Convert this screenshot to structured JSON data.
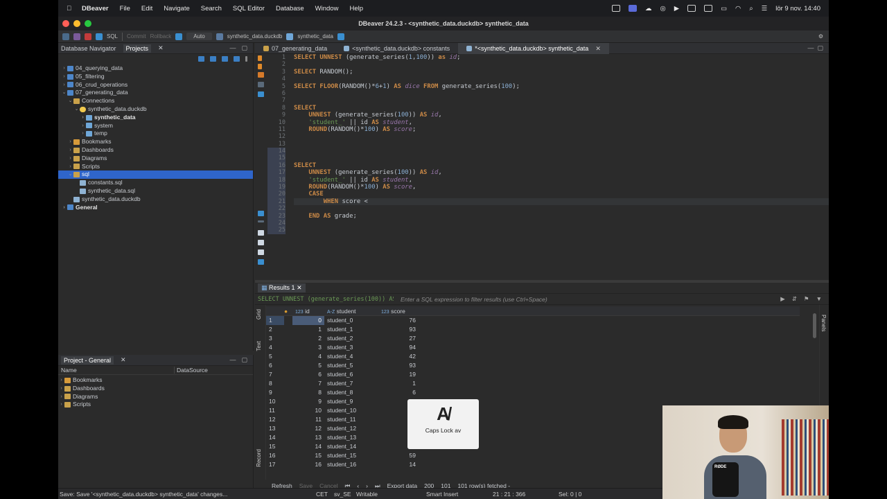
{
  "menubar": {
    "app": "DBeaver",
    "items": [
      "File",
      "Edit",
      "Navigate",
      "Search",
      "SQL Editor",
      "Database",
      "Window",
      "Help"
    ],
    "clock": "lör 9 nov. 14:40"
  },
  "window": {
    "title": "DBeaver 24.2.3 - <synthetic_data.duckdb> synthetic_data",
    "toolbar": {
      "sql_label": "SQL",
      "commit_label": "Commit",
      "rollback_label": "Rollback",
      "auto_label": "Auto",
      "datasource": "synthetic_data.duckdb",
      "schema": "synthetic_data"
    }
  },
  "left": {
    "tabs": [
      "Database Navigator",
      "Projects"
    ],
    "tree": [
      {
        "label": "04_querying_data",
        "icon": "project-icon",
        "indent": 0,
        "arrow": "›"
      },
      {
        "label": "05_filtering",
        "icon": "project-icon",
        "indent": 0,
        "arrow": "›"
      },
      {
        "label": "06_crud_operations",
        "icon": "project-icon",
        "indent": 0,
        "arrow": "›"
      },
      {
        "label": "07_generating_data",
        "icon": "project-icon",
        "indent": 0,
        "arrow": "⌄"
      },
      {
        "label": "Connections",
        "icon": "folder-icon",
        "indent": 1,
        "arrow": "⌄"
      },
      {
        "label": "synthetic_data.duckdb",
        "icon": "database-icon",
        "indent": 2,
        "arrow": "⌄"
      },
      {
        "label": "synthetic_data",
        "icon": "schema-icon",
        "indent": 3,
        "arrow": "›",
        "bold": true
      },
      {
        "label": "system",
        "icon": "schema-icon",
        "indent": 3,
        "arrow": "›"
      },
      {
        "label": "temp",
        "icon": "schema-icon",
        "indent": 3,
        "arrow": "›"
      },
      {
        "label": "Bookmarks",
        "icon": "bookmark-icon",
        "indent": 1,
        "arrow": "›"
      },
      {
        "label": "Dashboards",
        "icon": "folder-icon",
        "indent": 1,
        "arrow": "›"
      },
      {
        "label": "Diagrams",
        "icon": "folder-icon",
        "indent": 1,
        "arrow": "›"
      },
      {
        "label": "Scripts",
        "icon": "folder-icon",
        "indent": 1,
        "arrow": "›"
      },
      {
        "label": "sql",
        "icon": "folder-icon",
        "indent": 1,
        "arrow": "⌄",
        "selected": true
      },
      {
        "label": "constants.sql",
        "icon": "file-icon",
        "indent": 2,
        "arrow": ""
      },
      {
        "label": "synthetic_data.sql",
        "icon": "file-icon",
        "indent": 2,
        "arrow": ""
      },
      {
        "label": "synthetic_data.duckdb",
        "icon": "file-icon",
        "indent": 1,
        "arrow": ""
      },
      {
        "label": "General",
        "icon": "project-icon",
        "indent": 0,
        "arrow": "›",
        "bold": true
      }
    ],
    "project_tab": "Project - General",
    "project_columns": [
      "Name",
      "DataSource"
    ],
    "project_items": [
      "Bookmarks",
      "Dashboards",
      "Diagrams",
      "Scripts"
    ]
  },
  "editor": {
    "tabs": [
      "07_generating_data",
      "<synthetic_data.duckdb> constants",
      "*<synthetic_data.duckdb> synthetic_data"
    ],
    "line_numbers": [
      "1",
      "2",
      "3",
      "4",
      "5",
      "6",
      "7",
      "8",
      "9",
      "10",
      "11",
      "12",
      "13",
      "14",
      "15",
      "16",
      "17",
      "18",
      "19",
      "20",
      "21",
      "22",
      "23",
      "24",
      "25"
    ],
    "code": [
      "SELECT UNNEST (generate_series(1,100)) as id;",
      "",
      "SELECT RANDOM();",
      "",
      "SELECT FLOOR(RANDOM()*6+1) AS dice FROM generate_series(100);",
      "",
      "",
      "SELECT",
      "    UNNEST (generate_series(100)) AS id,",
      "    'student_' || id AS student,",
      "    ROUND(RANDOM()*100) AS score;",
      "",
      "",
      "",
      "",
      "SELECT",
      "    UNNEST (generate_series(100)) AS id,",
      "    'student_' || id AS student,",
      "    ROUND(RANDOM()*100) AS score,",
      "    CASE",
      "        WHEN score <",
      "",
      "    END AS grade;",
      "",
      ""
    ]
  },
  "results": {
    "tab": "Results 1",
    "filter_query": "SELECT UNNEST (generate_series(100)) AS id,",
    "filter_hint": "Enter a SQL expression to filter results (use Ctrl+Space)",
    "side_tabs": [
      "Grid",
      "Text",
      "Record"
    ],
    "right_tab": "Panels",
    "columns": [
      {
        "type": "123",
        "name": "id"
      },
      {
        "type": "A-Z",
        "name": "student"
      },
      {
        "type": "123",
        "name": "score"
      }
    ],
    "rows": [
      {
        "n": "1",
        "id": "0",
        "student": "student_0",
        "score": "76"
      },
      {
        "n": "2",
        "id": "1",
        "student": "student_1",
        "score": "93"
      },
      {
        "n": "3",
        "id": "2",
        "student": "student_2",
        "score": "27"
      },
      {
        "n": "4",
        "id": "3",
        "student": "student_3",
        "score": "94"
      },
      {
        "n": "5",
        "id": "4",
        "student": "student_4",
        "score": "42"
      },
      {
        "n": "6",
        "id": "5",
        "student": "student_5",
        "score": "93"
      },
      {
        "n": "7",
        "id": "6",
        "student": "student_6",
        "score": "19"
      },
      {
        "n": "8",
        "id": "7",
        "student": "student_7",
        "score": "1"
      },
      {
        "n": "9",
        "id": "8",
        "student": "student_8",
        "score": "6"
      },
      {
        "n": "10",
        "id": "9",
        "student": "student_9",
        "score": "5"
      },
      {
        "n": "11",
        "id": "10",
        "student": "student_10",
        "score": "4"
      },
      {
        "n": "12",
        "id": "11",
        "student": "student_11",
        "score": "7"
      },
      {
        "n": "13",
        "id": "12",
        "student": "student_12",
        "score": "8"
      },
      {
        "n": "14",
        "id": "13",
        "student": "student_13",
        "score": ""
      },
      {
        "n": "15",
        "id": "14",
        "student": "student_14",
        "score": "1"
      },
      {
        "n": "16",
        "id": "15",
        "student": "student_15",
        "score": "59"
      },
      {
        "n": "17",
        "id": "16",
        "student": "student_16",
        "score": "14"
      }
    ],
    "bottom": {
      "refresh": "Refresh",
      "save": "Save",
      "cancel": "Cancel",
      "export": "Export data",
      "fetch_size": "200",
      "row_count": "101",
      "fetched": "101 row(s) fetched -"
    }
  },
  "status": {
    "message": "Save: Save '<synthetic_data.duckdb> synthetic_data' changes...",
    "timezone": "CET",
    "locale": "sv_SE",
    "mode": "Writable",
    "insert": "Smart Insert",
    "position": "21 : 21 : 366",
    "selection": "Sel: 0 | 0"
  },
  "overlay": {
    "capslock_label": "Caps Lock av",
    "webcam_mic_text": "RØDE"
  }
}
